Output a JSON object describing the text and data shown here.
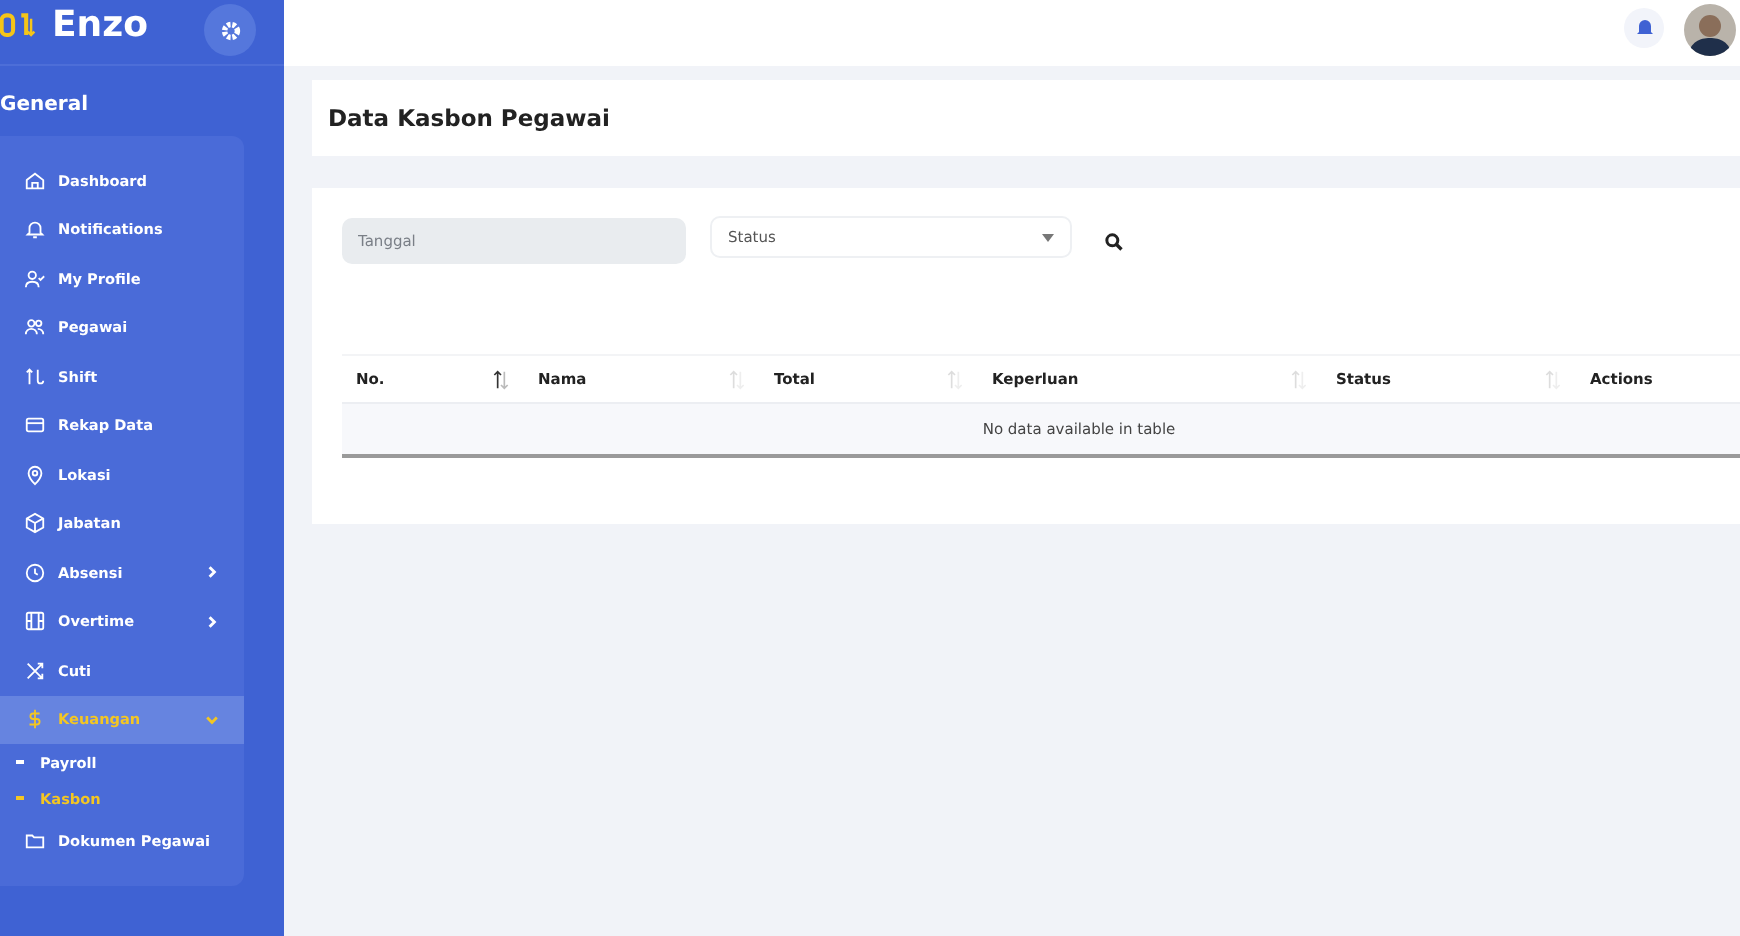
{
  "sidebar": {
    "brand": "Enzo",
    "section_title": "General",
    "items": [
      {
        "label": "Dashboard",
        "selected": false
      },
      {
        "label": "Notifications",
        "selected": false
      },
      {
        "label": "My Profile",
        "selected": false
      },
      {
        "label": "Pegawai",
        "selected": false
      },
      {
        "label": "Shift",
        "selected": false
      },
      {
        "label": "Rekap Data",
        "selected": false
      },
      {
        "label": "Lokasi",
        "selected": false
      },
      {
        "label": "Jabatan",
        "selected": false
      },
      {
        "label": "Absensi",
        "selected": false,
        "expanded": false
      },
      {
        "label": "Overtime",
        "selected": false,
        "expanded": false
      },
      {
        "label": "Cuti",
        "selected": false
      },
      {
        "label": "Keuangan",
        "selected": true,
        "expanded": true,
        "children": [
          {
            "label": "Payroll",
            "selected": false
          },
          {
            "label": "Kasbon",
            "selected": true
          }
        ]
      },
      {
        "label": "Dokumen Pegawai",
        "selected": false
      }
    ]
  },
  "page_title": "Data Kasbon Pegawai",
  "filters": {
    "date": {
      "placeholder": "Tanggal"
    },
    "status": {
      "placeholder": "Status"
    }
  },
  "table": {
    "columns": [
      {
        "label": "No.",
        "sorted": true
      },
      {
        "label": "Nama",
        "sorted": false
      },
      {
        "label": "Total",
        "sorted": false
      },
      {
        "label": "Keperluan",
        "sorted": false
      },
      {
        "label": "Status",
        "sorted": false
      },
      {
        "label": "Actions"
      }
    ],
    "empty_message": "No data available in table"
  }
}
